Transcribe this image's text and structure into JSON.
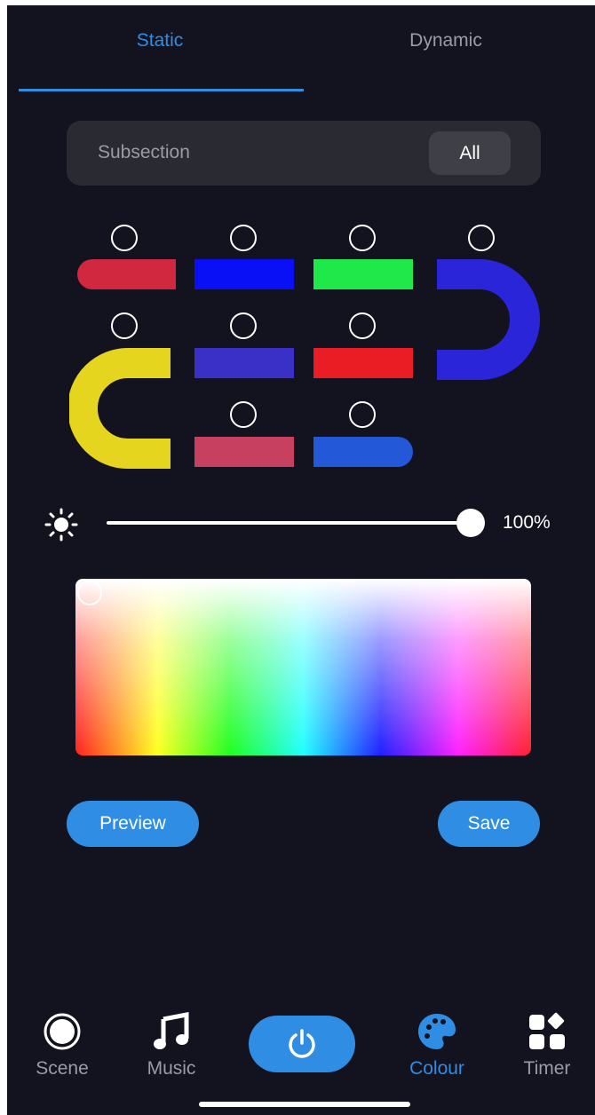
{
  "tabs": {
    "static": "Static",
    "dynamic": "Dynamic",
    "active": "static"
  },
  "subsection": {
    "label": "Subsection",
    "button": "All"
  },
  "segments": [
    {
      "shape": "pill-left",
      "color": "#d2283f"
    },
    {
      "shape": "rect",
      "color": "#0a10f5"
    },
    {
      "shape": "rect",
      "color": "#1ee84a"
    },
    {
      "shape": "arc-right",
      "color": "#2b25d9"
    },
    {
      "shape": "arc-left",
      "color": "#e6d51f"
    },
    {
      "shape": "rect",
      "color": "#3a30c8"
    },
    {
      "shape": "rect",
      "color": "#ea1c24"
    },
    {
      "shape": "rect",
      "color": "#c8405f"
    },
    {
      "shape": "pill-right",
      "color": "#2358d8"
    }
  ],
  "brightness": {
    "icon": "sun-icon",
    "value": 1.0,
    "label": "100%"
  },
  "color_picker": {
    "handle_icon": "picker-handle"
  },
  "buttons": {
    "preview": "Preview",
    "save": "Save"
  },
  "nav": {
    "scene": {
      "label": "Scene",
      "icon": "scene-icon"
    },
    "music": {
      "label": "Music",
      "icon": "music-note-icon"
    },
    "power": {
      "icon": "power-icon"
    },
    "colour": {
      "label": "Colour",
      "icon": "palette-icon",
      "active": true
    },
    "timer": {
      "label": "Timer",
      "icon": "timer-grid-icon"
    }
  },
  "colors": {
    "accent": "#2f8de4",
    "background": "#13121f",
    "muted_text": "#9b9ba6"
  }
}
